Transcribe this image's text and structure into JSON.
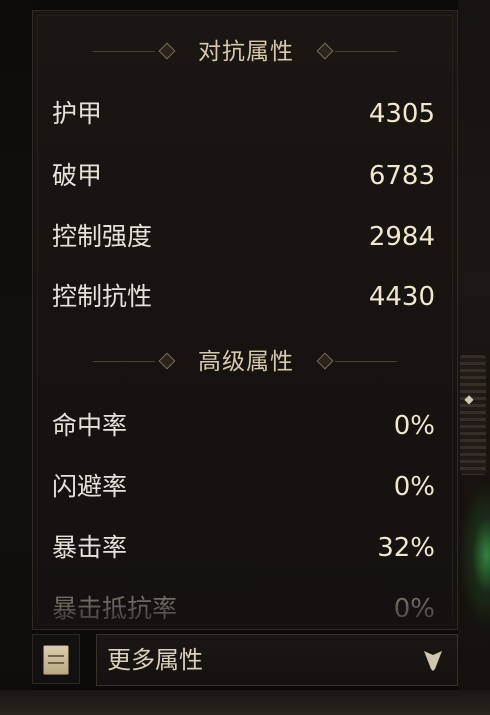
{
  "sections": [
    {
      "title": "对抗属性",
      "stats": [
        {
          "label": "护甲",
          "value": "4305"
        },
        {
          "label": "破甲",
          "value": "6783"
        },
        {
          "label": "控制强度",
          "value": "2984"
        },
        {
          "label": "控制抗性",
          "value": "4430"
        }
      ]
    },
    {
      "title": "高级属性",
      "stats": [
        {
          "label": "命中率",
          "value": "0%"
        },
        {
          "label": "闪避率",
          "value": "0%"
        },
        {
          "label": "暴击率",
          "value": "32%"
        },
        {
          "label": "暴击抵抗率",
          "value": "0%"
        }
      ]
    }
  ],
  "footer": {
    "dropdown_label": "更多属性",
    "icon": "scroll-icon",
    "dropdown_icon": "chevron-down-icon"
  },
  "colors": {
    "panel_bg": "#171310",
    "header_text": "#d6c9ad",
    "label_text": "#e6e2da",
    "value_text": "#efe7cf"
  }
}
